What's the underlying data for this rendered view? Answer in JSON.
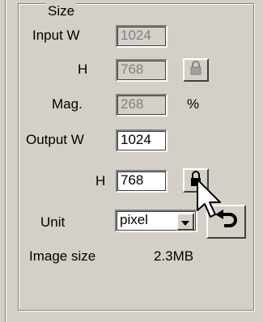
{
  "group_title": "Size",
  "input": {
    "w_label": "Input W",
    "w_value": "1024",
    "h_label": "H",
    "h_value": "768"
  },
  "mag": {
    "label": "Mag.",
    "value": "268",
    "unit": "%"
  },
  "output": {
    "w_label": "Output W",
    "w_value": "1024",
    "h_label": "H",
    "h_value": "768"
  },
  "unit": {
    "label": "Unit",
    "selected": "pixel"
  },
  "image_size": {
    "label": "Image size",
    "value": "2.3MB"
  },
  "icons": {
    "input_lock": "lock-icon",
    "output_lock": "lock-icon",
    "dropdown": "chevron-down-icon",
    "reset": "undo-arrow-icon",
    "cursor": "mouse-pointer-icon"
  }
}
